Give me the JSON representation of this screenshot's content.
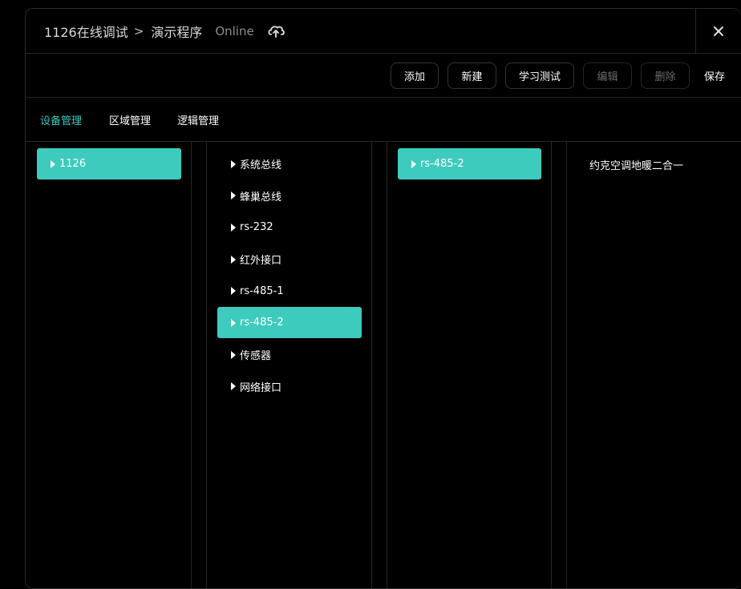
{
  "header": {
    "app_name": "1126在线调试",
    "separator": ">",
    "program_name": "演示程序",
    "status": "Online",
    "cloud_icon": "cloud-sync-icon",
    "close_icon": "close-icon"
  },
  "toolbar": {
    "add_label": "添加",
    "new_label": "新建",
    "learn_test_label": "学习测试",
    "edit_label": "编辑",
    "delete_label": "删除",
    "save_label": "保存"
  },
  "tabs": [
    {
      "label": "设备管理",
      "active": true
    },
    {
      "label": "区域管理",
      "active": false
    },
    {
      "label": "逻辑管理",
      "active": false
    }
  ],
  "columns": {
    "devices": [
      {
        "label": "1126",
        "selected": true
      }
    ],
    "interfaces": [
      {
        "label": "系统总线",
        "selected": false
      },
      {
        "label": "蜂巢总线",
        "selected": false
      },
      {
        "label": "rs-232",
        "selected": false
      },
      {
        "label": "红外接口",
        "selected": false
      },
      {
        "label": "rs-485-1",
        "selected": false
      },
      {
        "label": "rs-485-2",
        "selected": true
      },
      {
        "label": "传感器",
        "selected": false
      },
      {
        "label": "网络接口",
        "selected": false
      }
    ],
    "ports": [
      {
        "label": "rs-485-2",
        "selected": true
      }
    ],
    "drivers": [
      {
        "label": "约克空调地暖二合一"
      }
    ]
  },
  "colors": {
    "accent": "#3dcbbd",
    "background": "#000000",
    "border": "#262626"
  }
}
